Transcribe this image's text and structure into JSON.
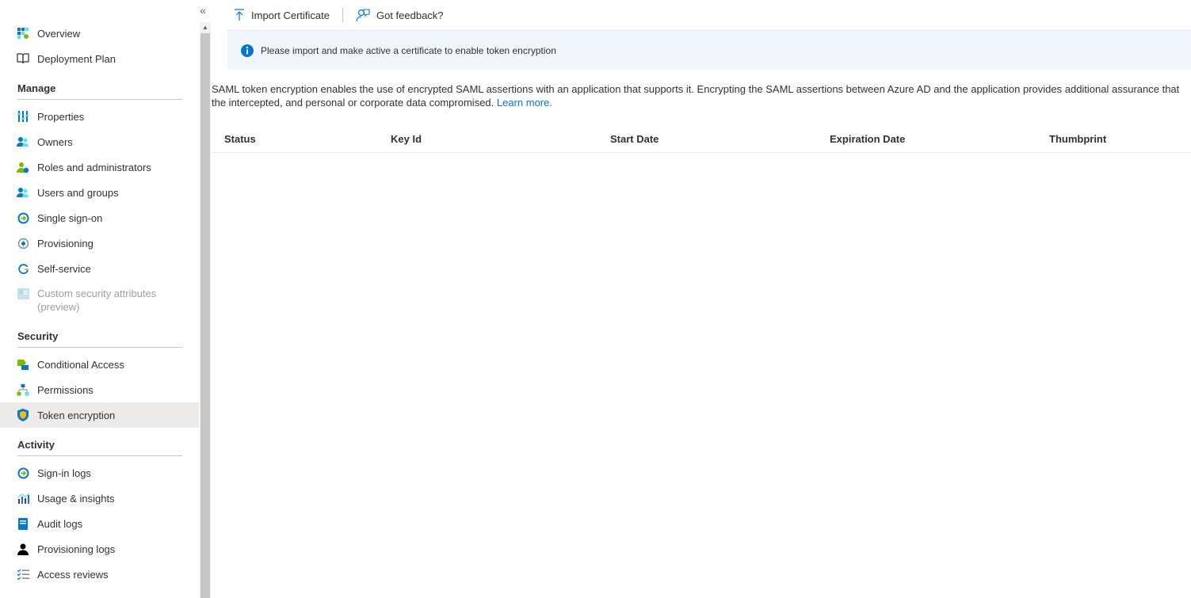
{
  "sidebar": {
    "collapse_glyph": "«",
    "items_top": [
      {
        "label": "Overview",
        "icon": "overview-icon"
      },
      {
        "label": "Deployment Plan",
        "icon": "book-icon"
      }
    ],
    "sections": [
      {
        "title": "Manage",
        "items": [
          {
            "label": "Properties",
            "icon": "properties-icon"
          },
          {
            "label": "Owners",
            "icon": "owners-icon"
          },
          {
            "label": "Roles and administrators",
            "icon": "roles-icon"
          },
          {
            "label": "Users and groups",
            "icon": "users-groups-icon"
          },
          {
            "label": "Single sign-on",
            "icon": "sso-icon"
          },
          {
            "label": "Provisioning",
            "icon": "provisioning-icon"
          },
          {
            "label": "Self-service",
            "icon": "self-service-icon"
          },
          {
            "label": "Custom security attributes (preview)",
            "icon": "custom-attributes-icon",
            "disabled": true
          }
        ]
      },
      {
        "title": "Security",
        "items": [
          {
            "label": "Conditional Access",
            "icon": "conditional-access-icon"
          },
          {
            "label": "Permissions",
            "icon": "permissions-icon"
          },
          {
            "label": "Token encryption",
            "icon": "shield-icon",
            "selected": true
          }
        ]
      },
      {
        "title": "Activity",
        "items": [
          {
            "label": "Sign-in logs",
            "icon": "sign-in-logs-icon"
          },
          {
            "label": "Usage & insights",
            "icon": "usage-insights-icon"
          },
          {
            "label": "Audit logs",
            "icon": "audit-logs-icon"
          },
          {
            "label": "Provisioning logs",
            "icon": "provisioning-logs-icon"
          },
          {
            "label": "Access reviews",
            "icon": "access-reviews-icon"
          }
        ]
      }
    ]
  },
  "toolbar": {
    "import_label": "Import Certificate",
    "feedback_label": "Got feedback?"
  },
  "info": {
    "message": "Please import and make active a certificate to enable token encryption"
  },
  "description": {
    "text": "SAML token encryption enables the use of encrypted SAML assertions with an application that supports it. Encrypting the SAML assertions between Azure AD and the application provides additional assurance that the intercepted, and personal or corporate data compromised.",
    "link": "Learn more."
  },
  "table": {
    "columns": [
      "Status",
      "Key Id",
      "Start Date",
      "Expiration Date",
      "Thumbprint"
    ]
  },
  "colors": {
    "accent": "#0078d4",
    "selected_bg": "#edebe9",
    "info_bg": "#eff6fc"
  }
}
